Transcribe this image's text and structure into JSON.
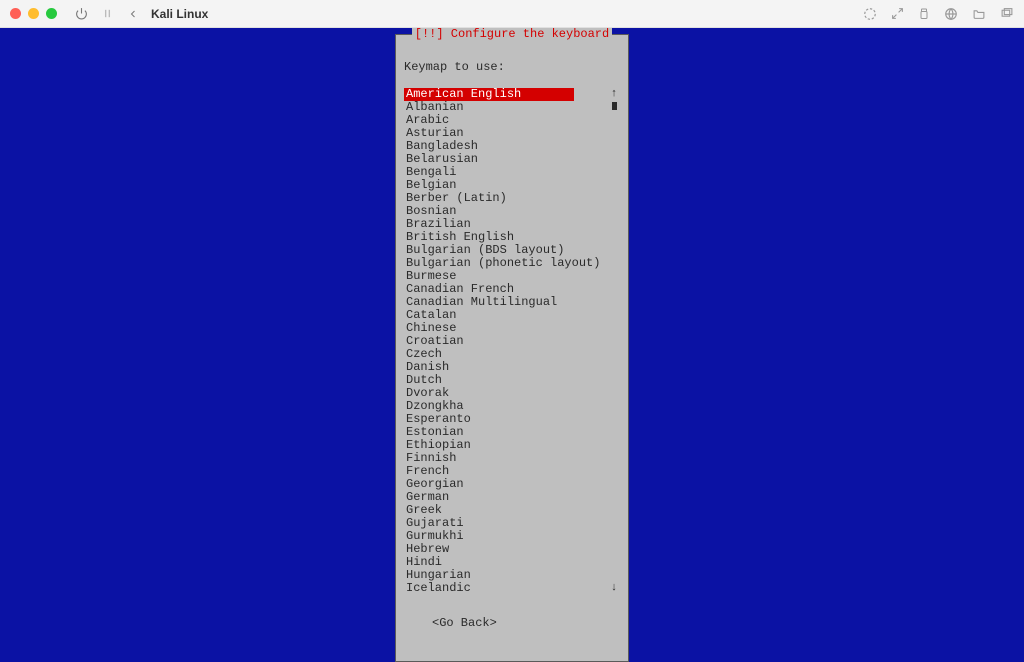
{
  "window": {
    "title": "Kali Linux"
  },
  "installer": {
    "box_title": "[!!] Configure the keyboard",
    "prompt": "Keymap to use:",
    "selected_index": 0,
    "keymaps": [
      "American English",
      "Albanian",
      "Arabic",
      "Asturian",
      "Bangladesh",
      "Belarusian",
      "Bengali",
      "Belgian",
      "Berber (Latin)",
      "Bosnian",
      "Brazilian",
      "British English",
      "Bulgarian (BDS layout)",
      "Bulgarian (phonetic layout)",
      "Burmese",
      "Canadian French",
      "Canadian Multilingual",
      "Catalan",
      "Chinese",
      "Croatian",
      "Czech",
      "Danish",
      "Dutch",
      "Dvorak",
      "Dzongkha",
      "Esperanto",
      "Estonian",
      "Ethiopian",
      "Finnish",
      "French",
      "Georgian",
      "German",
      "Greek",
      "Gujarati",
      "Gurmukhi",
      "Hebrew",
      "Hindi",
      "Hungarian",
      "Icelandic"
    ],
    "go_back": "<Go Back>"
  },
  "colors": {
    "vm_bg": "#0b12a4",
    "box_bg": "#bfbfbf",
    "title_red": "#d40000",
    "selected_bg": "#d40000"
  }
}
